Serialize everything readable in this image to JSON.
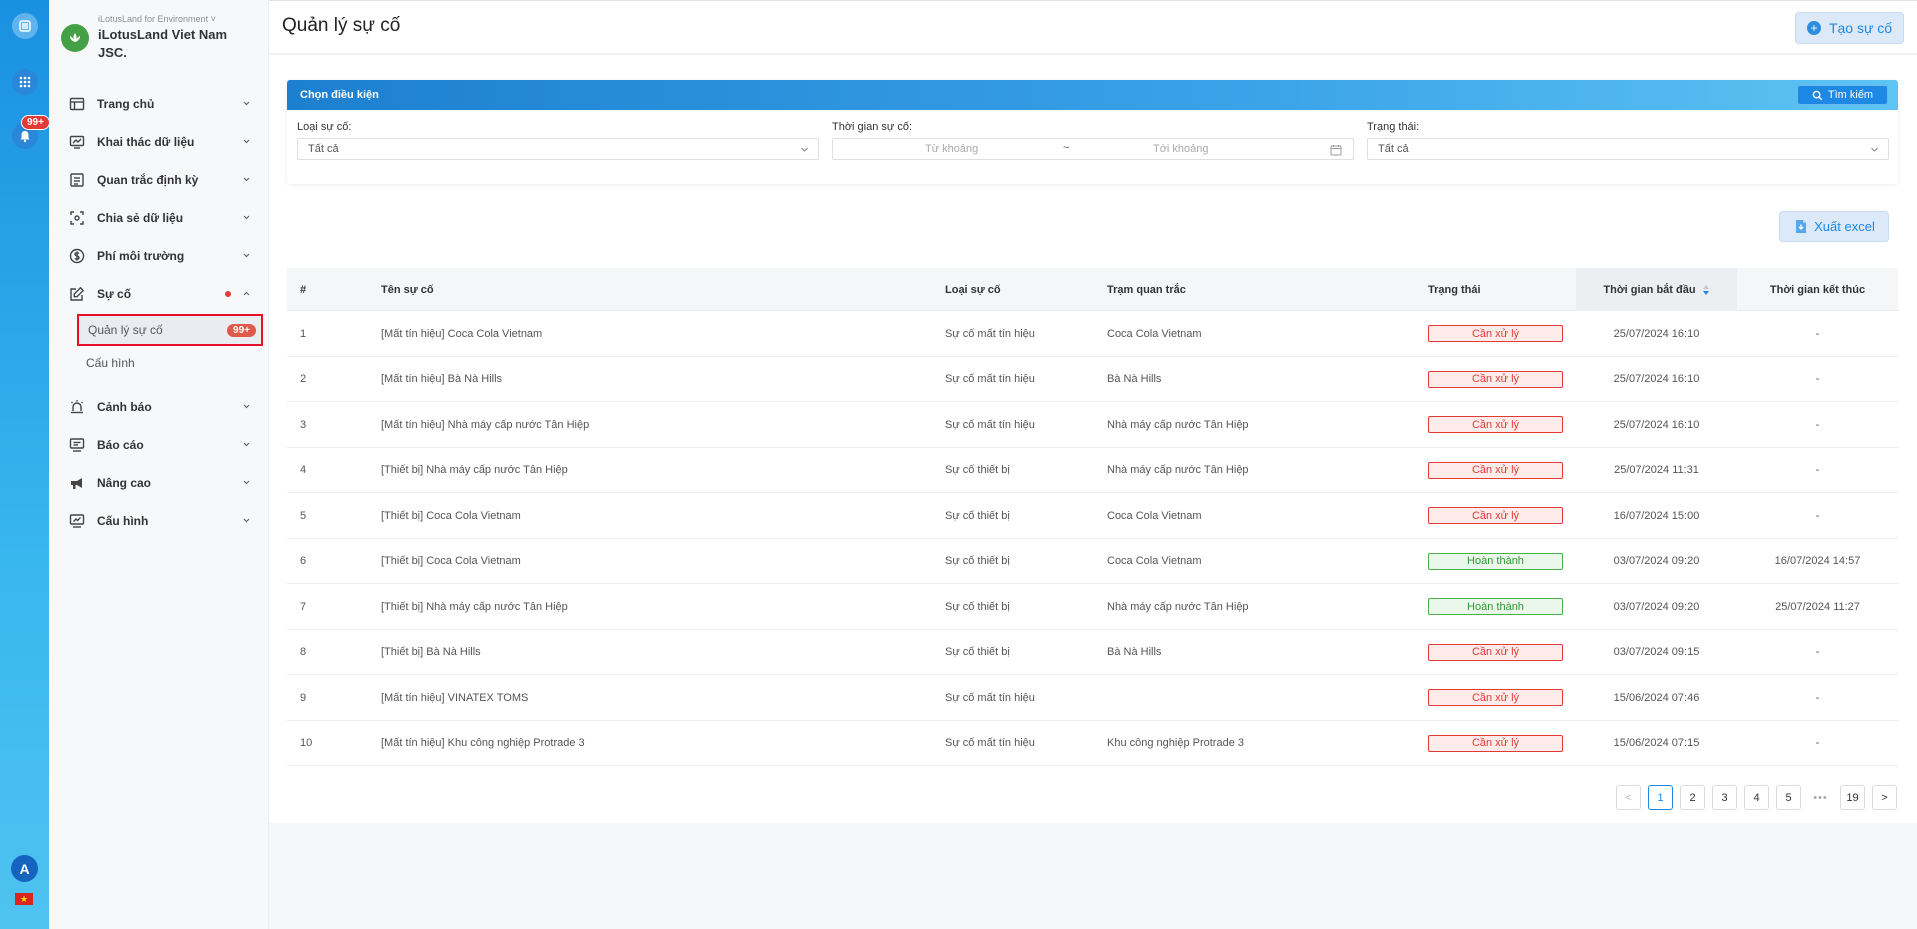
{
  "rail": {
    "badge": "99+",
    "avatar": "A",
    "flag_star": "★"
  },
  "org": {
    "sub": "iLotusLand for Environment ˅",
    "name": "iLotusLand Viet Nam JSC."
  },
  "nav": {
    "items": [
      {
        "label": "Trang chủ"
      },
      {
        "label": "Khai thác dữ liệu"
      },
      {
        "label": "Quan trắc định kỳ"
      },
      {
        "label": "Chia sẻ dữ liệu"
      },
      {
        "label": "Phí môi trường"
      },
      {
        "label": "Sự cố"
      },
      {
        "label": "Cảnh báo"
      },
      {
        "label": "Báo cáo"
      },
      {
        "label": "Nâng cao"
      },
      {
        "label": "Cấu hình"
      }
    ],
    "sub": [
      {
        "label": "Quản lý sự cố",
        "badge": "99+"
      },
      {
        "label": "Cấu hình"
      }
    ]
  },
  "header": {
    "title": "Quản lý sự cố",
    "create_label": "Tạo sự cố"
  },
  "filter": {
    "title": "Chọn điều kiện",
    "search_label": "Tìm kiếm",
    "type_label": "Loại sự cố:",
    "type_value": "Tất cả",
    "time_label": "Thời gian sự cố:",
    "time_from_placeholder": "Từ khoảng",
    "time_sep": "~",
    "time_to_placeholder": "Tới khoảng",
    "status_label": "Trạng thái:",
    "status_value": "Tất cả"
  },
  "export_label": "Xuất excel",
  "table": {
    "headers": [
      "#",
      "Tên sự cố",
      "Loại sự cố",
      "Trạm quan trắc",
      "Trạng thái",
      "Thời gian bắt đầu",
      "Thời gian kết thúc"
    ],
    "rows": [
      {
        "no": "1",
        "name": "[Mất tín hiệu] Coca Cola Vietnam",
        "type": "Sự cố mất tín hiệu",
        "station": "Coca Cola Vietnam",
        "status": "Cần xử lý",
        "status_kind": "pending",
        "start": "25/07/2024 16:10",
        "end": "-"
      },
      {
        "no": "2",
        "name": "[Mất tín hiệu] Bà Nà Hills",
        "type": "Sự cố mất tín hiệu",
        "station": "Bà Nà Hills",
        "status": "Cần xử lý",
        "status_kind": "pending",
        "start": "25/07/2024 16:10",
        "end": "-"
      },
      {
        "no": "3",
        "name": "[Mất tín hiệu] Nhà máy cấp nước Tân Hiệp",
        "type": "Sự cố mất tín hiệu",
        "station": "Nhà máy cấp nước Tân Hiệp",
        "status": "Cần xử lý",
        "status_kind": "pending",
        "start": "25/07/2024 16:10",
        "end": "-"
      },
      {
        "no": "4",
        "name": "[Thiết bị] Nhà máy cấp nước Tân Hiệp",
        "type": "Sự cố thiết bị",
        "station": "Nhà máy cấp nước Tân Hiệp",
        "status": "Cần xử lý",
        "status_kind": "pending",
        "start": "25/07/2024 11:31",
        "end": "-"
      },
      {
        "no": "5",
        "name": "[Thiết bị] Coca Cola Vietnam",
        "type": "Sự cố thiết bị",
        "station": "Coca Cola Vietnam",
        "status": "Cần xử lý",
        "status_kind": "pending",
        "start": "16/07/2024 15:00",
        "end": "-"
      },
      {
        "no": "6",
        "name": "[Thiết bị] Coca Cola Vietnam",
        "type": "Sự cố thiết bị",
        "station": "Coca Cola Vietnam",
        "status": "Hoàn thành",
        "status_kind": "done",
        "start": "03/07/2024 09:20",
        "end": "16/07/2024 14:57"
      },
      {
        "no": "7",
        "name": "[Thiết bị] Nhà máy cấp nước Tân Hiệp",
        "type": "Sự cố thiết bị",
        "station": "Nhà máy cấp nước Tân Hiệp",
        "status": "Hoàn thành",
        "status_kind": "done",
        "start": "03/07/2024 09:20",
        "end": "25/07/2024 11:27"
      },
      {
        "no": "8",
        "name": "[Thiết bị] Bà Nà Hills",
        "type": "Sự cố thiết bị",
        "station": "Bà Nà Hills",
        "status": "Cần xử lý",
        "status_kind": "pending",
        "start": "03/07/2024 09:15",
        "end": "-"
      },
      {
        "no": "9",
        "name": "[Mất tín hiệu] VINATEX TOMS",
        "type": "Sự cố mất tín hiệu",
        "station": "",
        "status": "Cần xử lý",
        "status_kind": "pending",
        "start": "15/06/2024 07:46",
        "end": "-"
      },
      {
        "no": "10",
        "name": "[Mất tín hiệu] Khu công nghiệp Protrade 3",
        "type": "Sự cố mất tín hiệu",
        "station": "Khu công nghiệp Protrade 3",
        "status": "Cần xử lý",
        "status_kind": "pending",
        "start": "15/06/2024 07:15",
        "end": "-"
      }
    ]
  },
  "pagination": {
    "prev": "<",
    "pages": [
      "1",
      "2",
      "3",
      "4",
      "5"
    ],
    "ellipsis": "•••",
    "last": "19",
    "next": ">",
    "current": "1"
  },
  "colors": {
    "accent": "#1e88e5",
    "danger": "#e53935",
    "success": "#2e9d34"
  }
}
